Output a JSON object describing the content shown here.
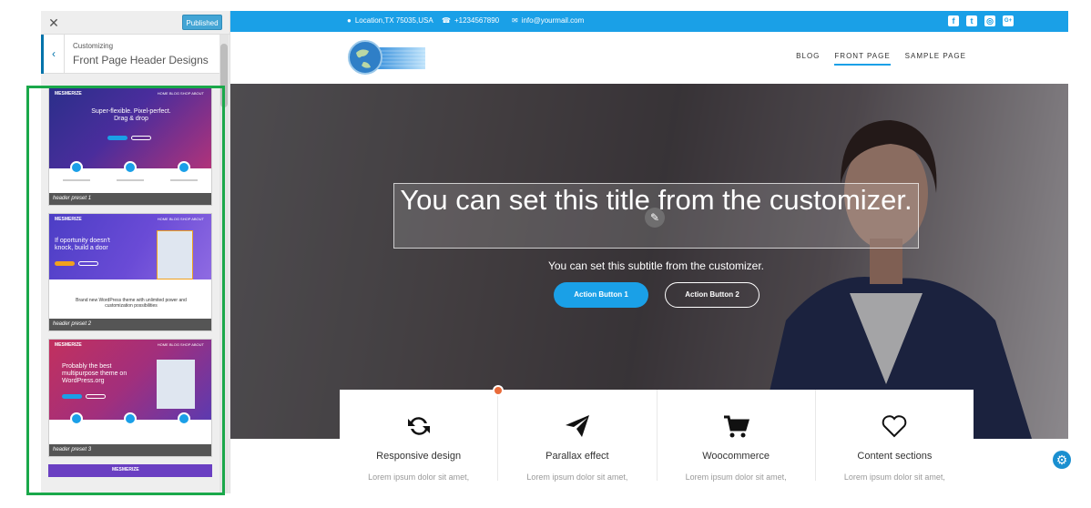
{
  "sidebar": {
    "close_label": "✕",
    "published_label": "Published",
    "back_label": "‹",
    "subtitle": "Customizing",
    "heading": "Front Page Header Designs",
    "presets": [
      {
        "brand": "MESMERIZE",
        "nav": "HOME  BLOG  SHOP  ABOUT",
        "headline": "Super-flexible. Pixel-perfect. Drag & drop",
        "label": "header preset 1"
      },
      {
        "brand": "MESMERIZE",
        "nav": "HOME  BLOG  SHOP  ABOUT",
        "headline": "If oportunity doesn't knock, build a door",
        "tagline": "Brand new WordPress theme with unlimited power and customization possibilities",
        "label": "header preset 2"
      },
      {
        "brand": "MESMERIZE",
        "nav": "HOME  BLOG  SHOP  ABOUT",
        "headline": "Probably the best multipurpose theme on WordPress.org",
        "label": "header preset 3"
      },
      {
        "brand": "MESMERIZE"
      }
    ]
  },
  "topbar": {
    "location": "Location,TX 75035,USA",
    "phone": "+1234567890",
    "email": "info@yourmail.com",
    "social": [
      "f",
      "t",
      "◎",
      "G+"
    ]
  },
  "nav": {
    "items": [
      "BLOG",
      "FRONT PAGE",
      "SAMPLE PAGE"
    ],
    "active": "FRONT PAGE"
  },
  "hero": {
    "title": "You can set this title from the customizer.",
    "subtitle": "You can set this subtitle from the customizer.",
    "button1": "Action Button 1",
    "button2": "Action Button 2"
  },
  "features": [
    {
      "icon": "refresh-icon",
      "title": "Responsive design",
      "desc": "Lorem ipsum dolor sit amet,"
    },
    {
      "icon": "paper-plane-icon",
      "title": "Parallax effect",
      "desc": "Lorem ipsum dolor sit amet,"
    },
    {
      "icon": "cart-icon",
      "title": "Woocommerce",
      "desc": "Lorem ipsum dolor sit amet,"
    },
    {
      "icon": "heart-icon",
      "title": "Content sections",
      "desc": "Lorem ipsum dolor sit amet,"
    }
  ],
  "colors": {
    "accent": "#1aa0e7",
    "highlight": "#1aa84a",
    "published": "#43a5d5"
  }
}
